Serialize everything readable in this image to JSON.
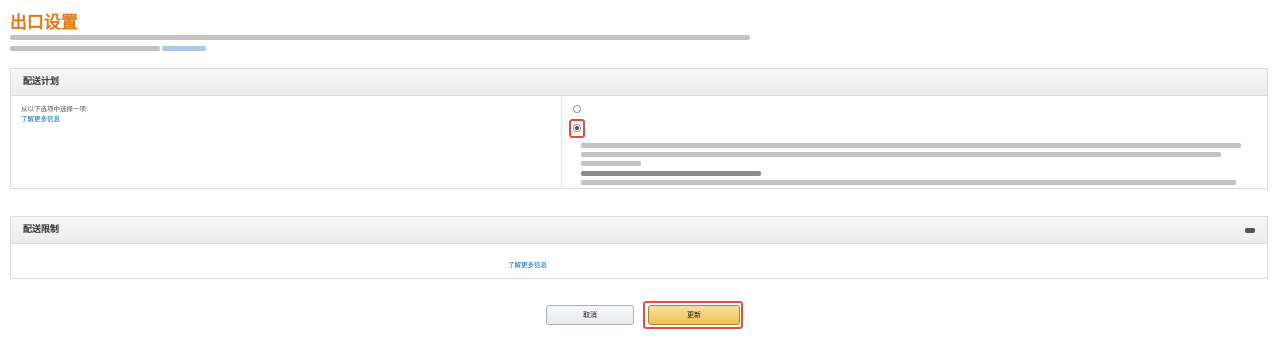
{
  "page": {
    "title": "出口设置"
  },
  "shipping_plan": {
    "header": "配送计划",
    "select_one_label": "从以下选项中选择一项:",
    "learn_more": "了解更多信息",
    "option_none_label": "",
    "option_export_label": "",
    "option_export_link": ""
  },
  "restrictions": {
    "header": "配送限制",
    "country_label": "",
    "learn_more": "了解更多信息",
    "value": ""
  },
  "footer": {
    "note_link": ""
  },
  "buttons": {
    "cancel": "取消",
    "update": "更新"
  },
  "colors": {
    "title": "#e47911",
    "link": "#0066c0",
    "highlight": "#e74c3c",
    "update_button": "#f0c14b"
  }
}
